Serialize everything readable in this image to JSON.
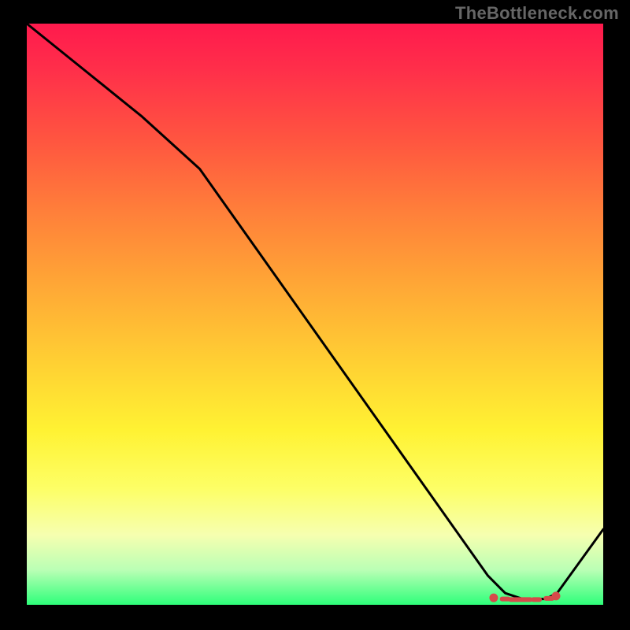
{
  "watermark": "TheBottleneck.com",
  "chart_data": {
    "type": "line",
    "title": "",
    "xlabel": "",
    "ylabel": "",
    "xlim": [
      0,
      100
    ],
    "ylim": [
      0,
      100
    ],
    "x": [
      0,
      10,
      20,
      30,
      40,
      50,
      60,
      70,
      80,
      83,
      86,
      88,
      90,
      92,
      100
    ],
    "values": [
      100,
      92,
      84,
      75,
      61,
      47,
      33,
      19,
      5,
      2,
      1,
      1,
      1,
      2,
      13
    ],
    "markers": {
      "x": [
        81,
        83,
        84.5,
        85.7,
        86.8,
        88.4,
        90.6,
        91.8
      ],
      "y": [
        1.2,
        1.0,
        0.9,
        0.9,
        0.9,
        0.9,
        1.1,
        1.5
      ],
      "style": "dots-and-dashes",
      "color": "#d64a4a"
    }
  }
}
